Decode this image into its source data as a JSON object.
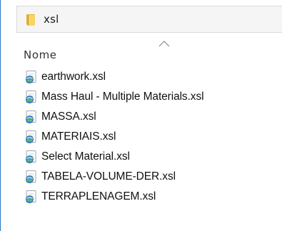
{
  "address_bar": {
    "path_label": "xsl",
    "icon": "folder-icon"
  },
  "columns": {
    "name_header": "Nome",
    "sort_indicator": "sort-ascending-icon"
  },
  "files": [
    {
      "name": "earthwork.xsl",
      "icon": "xsl-file-icon"
    },
    {
      "name": "Mass Haul - Multiple Materials.xsl",
      "icon": "xsl-file-icon"
    },
    {
      "name": "MASSA.xsl",
      "icon": "xsl-file-icon"
    },
    {
      "name": "MATERIAIS.xsl",
      "icon": "xsl-file-icon"
    },
    {
      "name": "Select Material.xsl",
      "icon": "xsl-file-icon"
    },
    {
      "name": "TABELA-VOLUME-DER.xsl",
      "icon": "xsl-file-icon"
    },
    {
      "name": "TERRAPLENAGEM.xsl",
      "icon": "xsl-file-icon"
    }
  ],
  "colors": {
    "frame_accent": "#2b78c5",
    "address_bar_bg": "#f5f5f5",
    "folder_yellow": "#f7d565"
  }
}
